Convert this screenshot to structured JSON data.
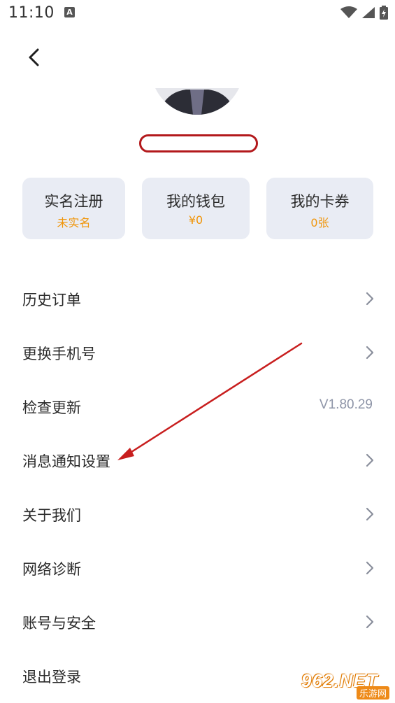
{
  "status_bar": {
    "time": "11:10",
    "notification_icon": "a-icon",
    "icons": [
      "wifi-icon",
      "signal-icon",
      "battery-charging-icon"
    ]
  },
  "header": {
    "back_icon": "chevron-left-icon"
  },
  "profile": {
    "avatar_icon": "avatar",
    "name": ""
  },
  "cards": [
    {
      "title": "实名注册",
      "value": "未实名"
    },
    {
      "title": "我的钱包",
      "value": "¥0"
    },
    {
      "title": "我的卡券",
      "value": "0张"
    }
  ],
  "menu": [
    {
      "label": "历史订单",
      "trailing": "chevron"
    },
    {
      "label": "更换手机号",
      "trailing": "chevron"
    },
    {
      "label": "检查更新",
      "trailing": "text",
      "value": "V1.80.29"
    },
    {
      "label": "消息通知设置",
      "trailing": "chevron"
    },
    {
      "label": "关于我们",
      "trailing": "chevron"
    },
    {
      "label": "网络诊断",
      "trailing": "chevron"
    },
    {
      "label": "账号与安全",
      "trailing": "chevron"
    },
    {
      "label": "退出登录",
      "trailing": "none"
    }
  ],
  "watermark": {
    "text": "962.NET",
    "sub": "乐游网"
  },
  "colors": {
    "card_bg": "#e9ecf4",
    "card_value": "#f0960c",
    "secondary_text": "#8e95a8",
    "annotation_red": "#c81e1e"
  }
}
